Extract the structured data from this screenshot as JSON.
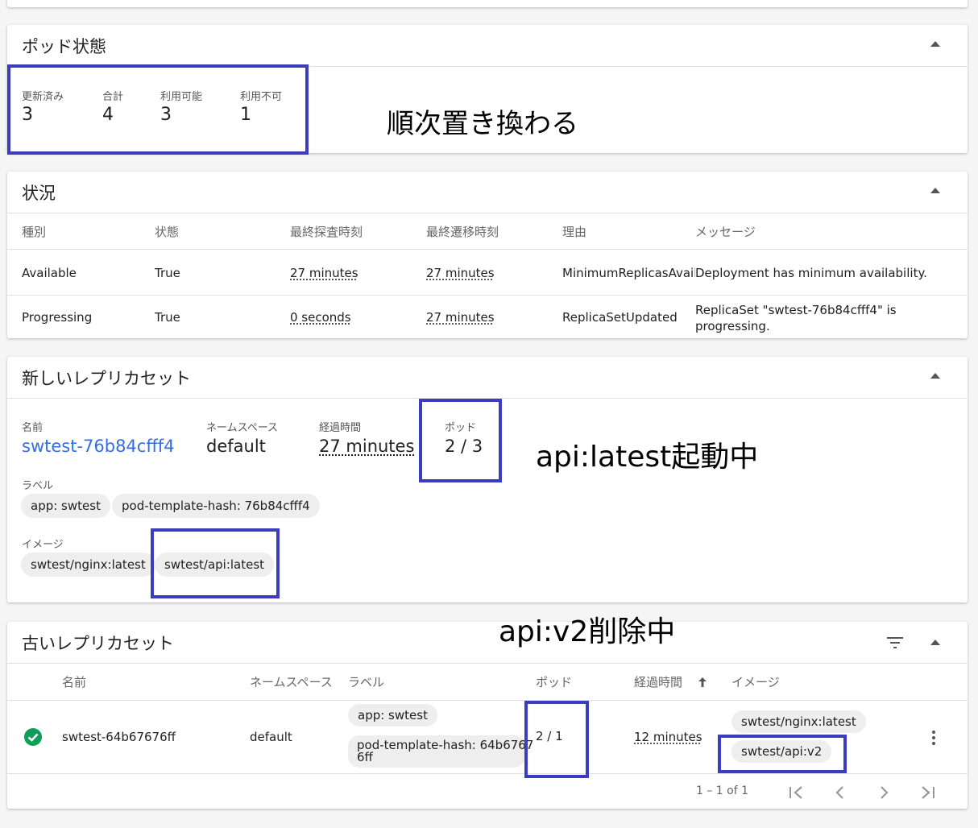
{
  "pod_status": {
    "title": "ポッド状態",
    "stats": [
      {
        "label": "更新済み",
        "value": "3"
      },
      {
        "label": "合計",
        "value": "4"
      },
      {
        "label": "利用可能",
        "value": "3"
      },
      {
        "label": "利用不可",
        "value": "1"
      }
    ],
    "annotation": "順次置き換わる"
  },
  "conditions": {
    "title": "状況",
    "headers": [
      "種別",
      "状態",
      "最終探査時刻",
      "最終遷移時刻",
      "理由",
      "メッセージ"
    ],
    "rows": [
      {
        "type": "Available",
        "status": "True",
        "probe": "27 minutes",
        "transition": "27 minutes",
        "reason": "MinimumReplicasAvailable",
        "message": "Deployment has minimum availability."
      },
      {
        "type": "Progressing",
        "status": "True",
        "probe": "0 seconds",
        "transition": "27 minutes",
        "reason": "ReplicaSetUpdated",
        "message_line1": "ReplicaSet \"swtest-76b84cfff4\" is",
        "message_line2": "progressing."
      }
    ]
  },
  "new_rs": {
    "title": "新しいレプリカセット",
    "name_label": "名前",
    "name": "swtest-76b84cfff4",
    "namespace_label": "ネームスペース",
    "namespace": "default",
    "age_label": "経過時間",
    "age": "27 minutes",
    "pods_label": "ポッド",
    "pods": "2 / 3",
    "labels_label": "ラベル",
    "labels": [
      "app: swtest",
      "pod-template-hash: 76b84cfff4"
    ],
    "images_label": "イメージ",
    "images": [
      "swtest/nginx:latest",
      "swtest/api:latest"
    ],
    "annotation": "api:latest起動中"
  },
  "old_rs": {
    "title": "古いレプリカセット",
    "annotation": "api:v2削除中",
    "headers": {
      "name": "名前",
      "namespace": "ネームスペース",
      "labels": "ラベル",
      "pods": "ポッド",
      "age": "経過時間",
      "images": "イメージ"
    },
    "row": {
      "name": "swtest-64b67676ff",
      "namespace": "default",
      "label1": "app: swtest",
      "label2_line1": "pod-template-hash: 64b6767",
      "label2_line2": "6ff",
      "pods": "2 / 1",
      "age": "12 minutes",
      "image1": "swtest/nginx:latest",
      "image2": "swtest/api:v2"
    },
    "pagination": "1 – 1 of 1"
  },
  "colors": {
    "link": "#326de6",
    "highlight": "#3c3cbe",
    "success": "#0f9d58"
  }
}
